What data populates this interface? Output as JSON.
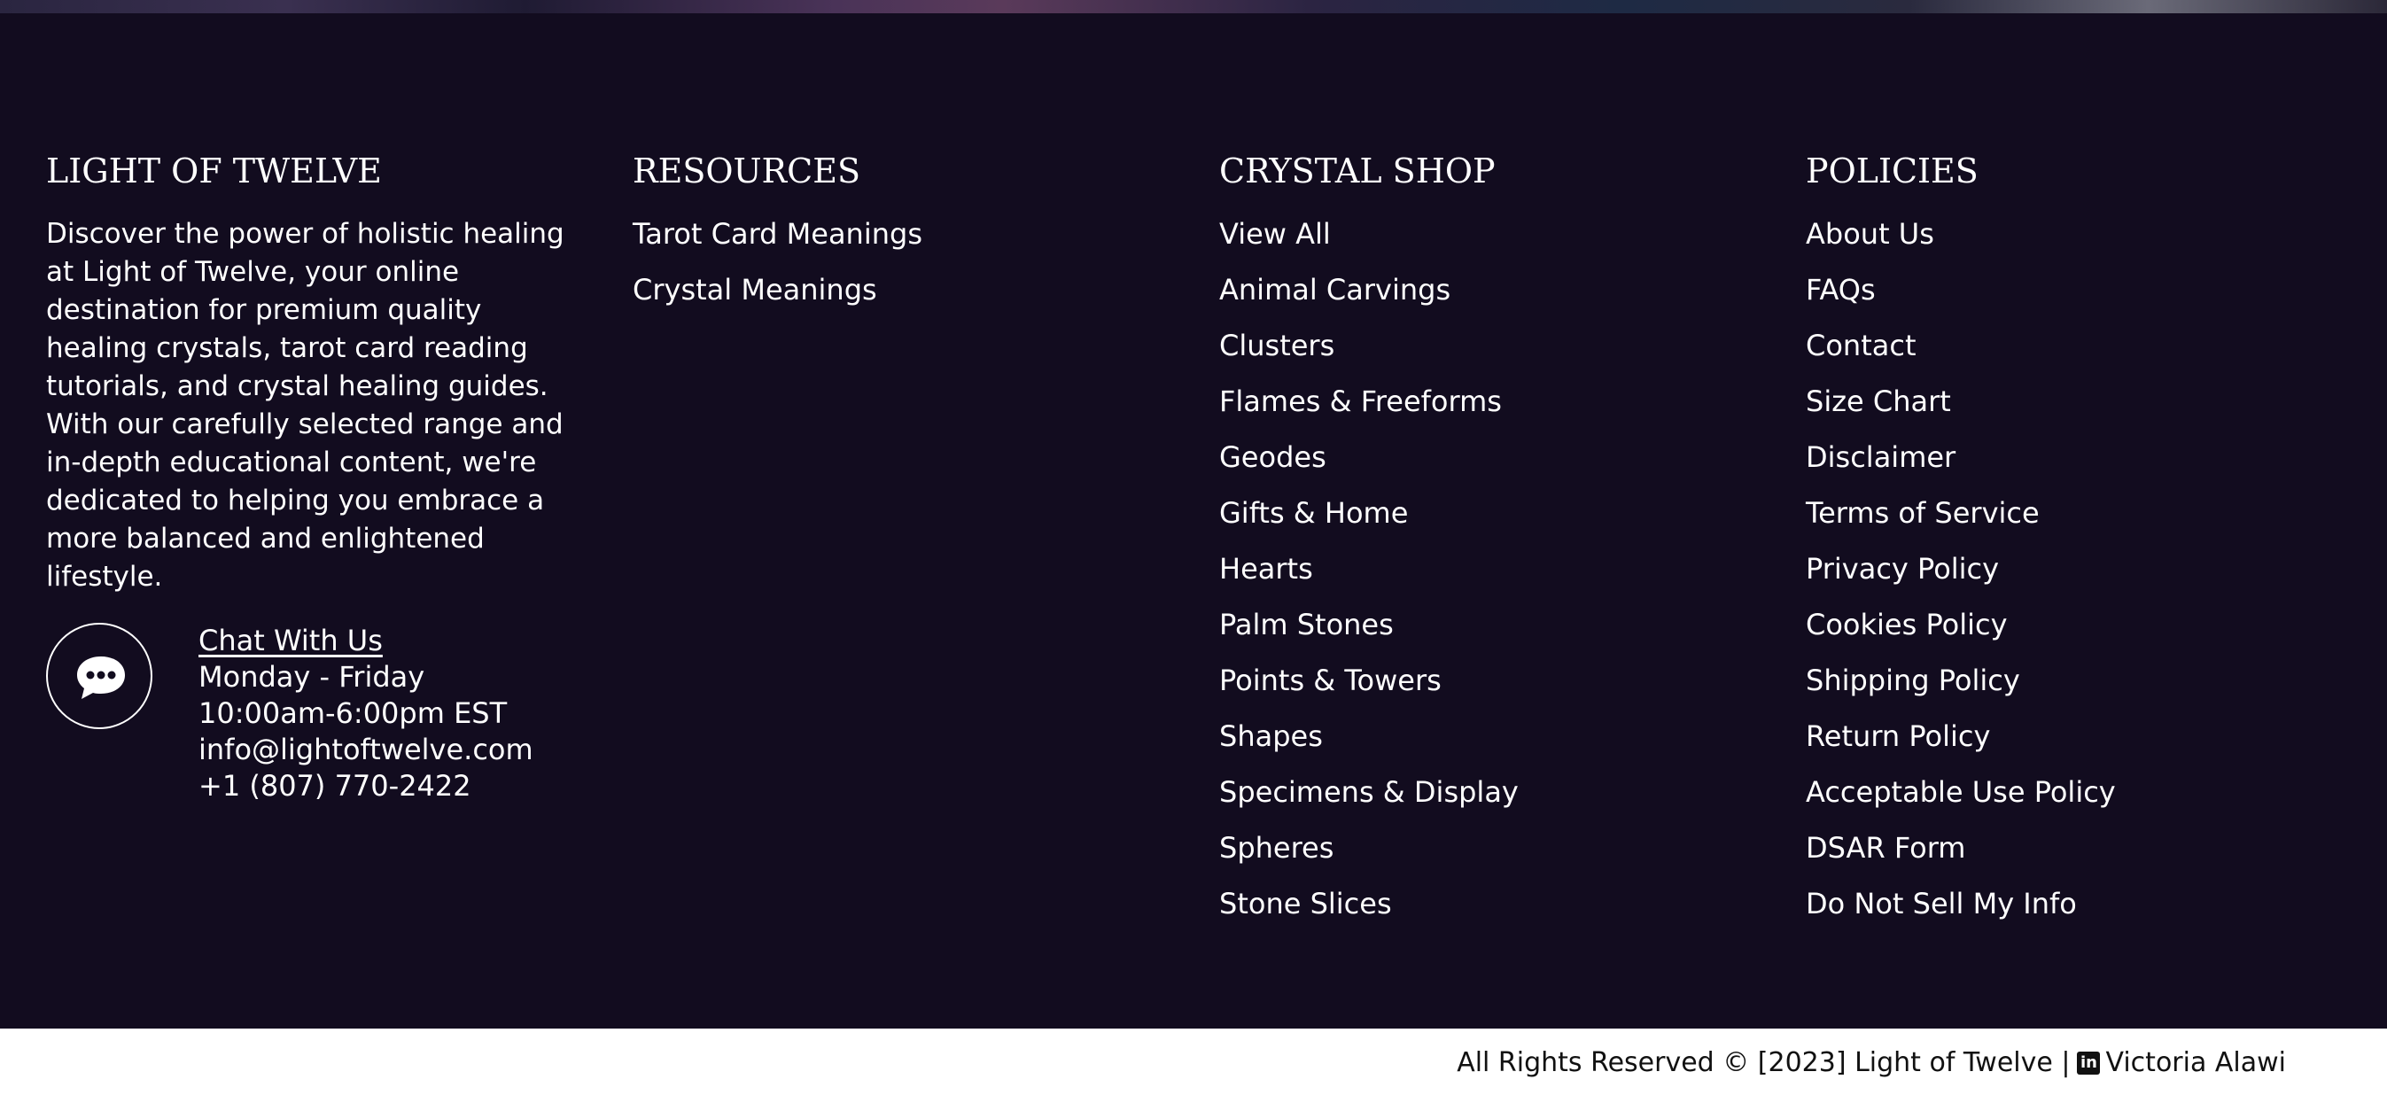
{
  "brand": {
    "title": "LIGHT OF TWELVE",
    "description": "Discover the power of holistic healing at Light of Twelve, your online destination for premium quality healing crystals, tarot card reading tutorials, and crystal healing guides. With our carefully selected range and in-depth educational content, we're dedicated to helping you embrace a more balanced and enlightened lifestyle."
  },
  "contact": {
    "chat_label": "Chat With Us",
    "days": "Monday - Friday",
    "hours": "10:00am-6:00pm EST",
    "email": "info@lightoftwelve.com",
    "phone": "+1 (807) 770-2422",
    "icon": "chat-bubble-icon"
  },
  "resources": {
    "title": "RESOURCES",
    "links": [
      "Tarot Card Meanings",
      "Crystal Meanings"
    ]
  },
  "shop": {
    "title": "CRYSTAL SHOP",
    "links": [
      "View All",
      "Animal Carvings",
      "Clusters",
      "Flames & Freeforms",
      "Geodes",
      "Gifts & Home",
      "Hearts",
      "Palm Stones",
      "Points & Towers",
      "Shapes",
      "Specimens & Display",
      "Spheres",
      "Stone Slices"
    ]
  },
  "policies": {
    "title": "POLICIES",
    "links": [
      "About Us",
      "FAQs",
      "Contact",
      "Size Chart",
      "Disclaimer",
      "Terms of Service",
      "Privacy Policy",
      "Cookies Policy",
      "Shipping Policy",
      "Return Policy",
      "Acceptable Use Policy",
      "DSAR Form",
      "Do Not Sell My Info"
    ]
  },
  "footer_bar": {
    "copyright": "All Rights Reserved © [2023] Light of Twelve |",
    "linkedin_icon": "linkedin-icon",
    "author": "Victoria Alawi"
  },
  "colors": {
    "footer_bg": "#120c1f",
    "text": "#ffffff",
    "bottom_bar_bg": "#ffffff",
    "bottom_bar_text": "#111111"
  }
}
